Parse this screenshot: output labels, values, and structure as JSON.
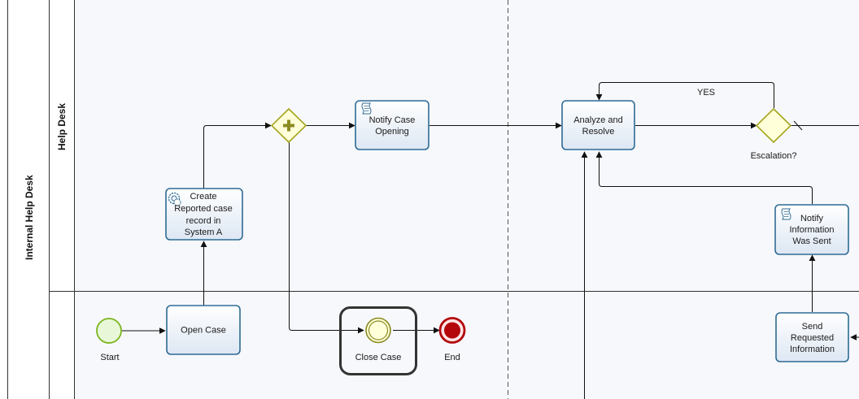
{
  "pool": {
    "label": "Internal Help Desk"
  },
  "lanes": [
    {
      "id": "help-desk",
      "label": "Help Desk"
    },
    {
      "id": "lower",
      "label": ""
    }
  ],
  "tasks": {
    "open_case": {
      "lines": [
        "Open Case"
      ]
    },
    "create_record": {
      "lines": [
        "Create",
        "Reported case",
        "record in",
        "System A"
      ],
      "icon": "gear-icon"
    },
    "notify_opening": {
      "lines": [
        "Notify Case",
        "Opening"
      ],
      "icon": "script-icon"
    },
    "analyze": {
      "lines": [
        "Analyze and",
        "Resolve"
      ]
    },
    "notify_info": {
      "lines": [
        "Notify",
        "Information",
        "Was Sent"
      ],
      "icon": "script-icon"
    },
    "send_info": {
      "lines": [
        "Send",
        "Requested",
        "Information"
      ]
    }
  },
  "events": {
    "start": {
      "label": "Start"
    },
    "close_case": {
      "label": "Close Case"
    },
    "end": {
      "label": "End"
    }
  },
  "gateways": {
    "parallel": {
      "label": "",
      "marker": "plus-icon"
    },
    "escalation": {
      "label": "Escalation?"
    }
  },
  "flow_labels": {
    "yes": "YES"
  },
  "colors": {
    "task_stroke": "#2e6b94",
    "task_fill_top": "#ffffff",
    "task_fill_bottom": "#dce6f2",
    "gateway_stroke": "#a5a51c",
    "gateway_fill": "#ffffd9",
    "start_stroke": "#7ab51d",
    "start_fill": "#e8f7d8",
    "end_fill": "#b3070c",
    "intermediate_stroke": "#8b8b23",
    "lane_bg": "#f7f8fc"
  }
}
